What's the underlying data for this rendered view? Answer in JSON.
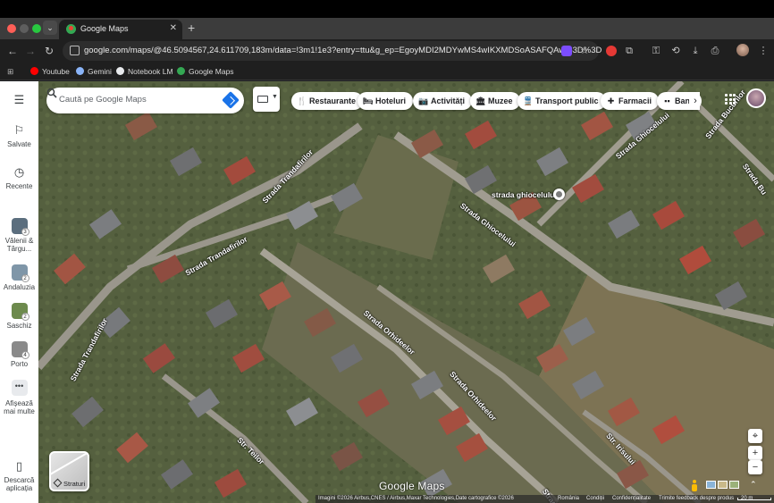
{
  "browser": {
    "tab_title": "Google Maps",
    "url": "google.com/maps/@46.5094567,24.611709,183m/data=!3m1!1e3?entry=ttu&g_ep=EgoyMDI2MDYwMS4wIKXMDSoASAFQAw%3D%3D",
    "bookmarks": [
      {
        "label": "Youtube",
        "color": "#ff0000"
      },
      {
        "label": "Gemini",
        "color": "#8ab4f8"
      },
      {
        "label": "Notebook LM",
        "color": "#e8eaed"
      },
      {
        "label": "Google Maps",
        "color": "#34a853"
      }
    ]
  },
  "rail": {
    "saved_label": "Salvate",
    "recent_label": "Recente",
    "recents": [
      {
        "label": "Vălenii & Târgu...",
        "badge": "3",
        "color": "#5b6e7e"
      },
      {
        "label": "Andaluzia",
        "badge": "2",
        "color": "#7f96a8"
      },
      {
        "label": "Saschiz",
        "badge": "2",
        "color": "#6d8a4d"
      },
      {
        "label": "Porto",
        "badge": "4",
        "color": "#8a8a8a"
      }
    ],
    "more_label": "Afișează mai multe",
    "download_label": "Descarcă aplicația"
  },
  "search": {
    "placeholder": "Caută pe Google Maps"
  },
  "chips": [
    {
      "label": "Restaurante",
      "icon": "restaurant-icon",
      "glyph": "🍴"
    },
    {
      "label": "Hoteluri",
      "icon": "hotel-icon",
      "glyph": "🛏"
    },
    {
      "label": "Activități",
      "icon": "camera-icon",
      "glyph": "📷"
    },
    {
      "label": "Muzee",
      "icon": "museum-icon",
      "glyph": "🏛"
    },
    {
      "label": "Transport public",
      "icon": "transit-icon",
      "glyph": "🚆"
    },
    {
      "label": "Farmacii",
      "icon": "pharmacy-icon",
      "glyph": "✚"
    },
    {
      "label": "Ban",
      "icon": "atm-icon",
      "glyph": "▪▪"
    }
  ],
  "map": {
    "roads": [
      {
        "name": "Strada Trandafirilor",
        "slot": "a"
      },
      {
        "name": "Strada Trandafirilor",
        "slot": "b"
      },
      {
        "name": "Strada Trandafirilor",
        "slot": "c"
      },
      {
        "name": "Strada Ghiocelului",
        "slot": "d"
      },
      {
        "name": "Strada Ghiocelului",
        "slot": "e"
      },
      {
        "name": "Strada Bucurilor",
        "slot": "f"
      },
      {
        "name": "Strada Bu",
        "slot": "g"
      },
      {
        "name": "Strada Orhideelor",
        "slot": "h"
      },
      {
        "name": "Strada Orhideelor",
        "slot": "i"
      },
      {
        "name": "Str. Teilor",
        "slot": "j"
      },
      {
        "name": "Str. Irisului",
        "slot": "k"
      },
      {
        "name": "Strada",
        "slot": "l"
      }
    ],
    "place_label": "strada ghiocelului",
    "layers_label": "Straturi",
    "logo": "Google Maps",
    "footer": {
      "imagery": "Imagini ©2026 Airbus,CNES / Airbus,Maxar Technologies,Date cartografice ©2026",
      "country": "România",
      "terms": "Condiții",
      "privacy": "Confidențialitate",
      "feedback": "Trimite feedback despre produs",
      "scale": "20 m"
    }
  }
}
